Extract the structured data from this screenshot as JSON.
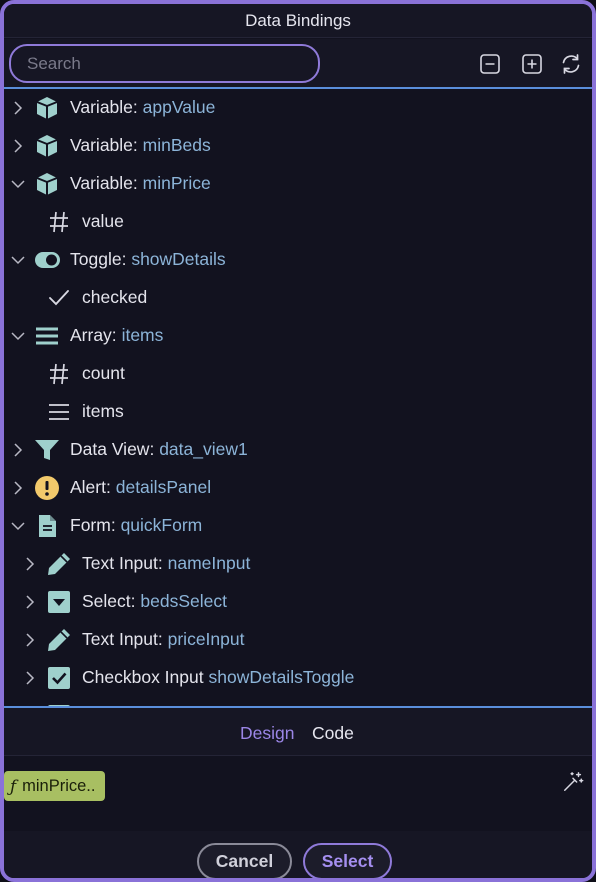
{
  "title": "Data Bindings",
  "search": {
    "placeholder": "Search",
    "value": ""
  },
  "toolbar": {
    "icons": [
      "collapse-all-icon",
      "expand-all-icon",
      "refresh-icon"
    ]
  },
  "tree": [
    {
      "type": "Variable:",
      "name": "appValue",
      "icon": "cube-icon",
      "depth": 0,
      "expanded": false
    },
    {
      "type": "Variable:",
      "name": "minBeds",
      "icon": "cube-icon",
      "depth": 0,
      "expanded": false
    },
    {
      "type": "Variable:",
      "name": "minPrice",
      "icon": "cube-icon",
      "depth": 0,
      "expanded": true
    },
    {
      "type": "value",
      "name": "",
      "icon": "hash-icon",
      "depth": 1,
      "leaf": true
    },
    {
      "type": "Toggle:",
      "name": "showDetails",
      "icon": "toggle-icon",
      "depth": 0,
      "expanded": true
    },
    {
      "type": "checked",
      "name": "",
      "icon": "check-icon",
      "depth": 1,
      "leaf": true
    },
    {
      "type": "Array:",
      "name": "items",
      "icon": "list-icon",
      "depth": 0,
      "expanded": true
    },
    {
      "type": "count",
      "name": "",
      "icon": "hash-icon",
      "depth": 1,
      "leaf": true
    },
    {
      "type": "items",
      "name": "",
      "icon": "list-thin-icon",
      "depth": 1,
      "leaf": true
    },
    {
      "type": "Data View:",
      "name": "data_view1",
      "icon": "filter-icon",
      "depth": 0,
      "expanded": false
    },
    {
      "type": "Alert:",
      "name": "detailsPanel",
      "icon": "alert-icon",
      "depth": 0,
      "expanded": false
    },
    {
      "type": "Form:",
      "name": "quickForm",
      "icon": "document-icon",
      "depth": 0,
      "expanded": true
    },
    {
      "type": "Text Input:",
      "name": "nameInput",
      "icon": "pencil-icon",
      "depth": 1,
      "expanded": false
    },
    {
      "type": "Select:",
      "name": "bedsSelect",
      "icon": "select-icon",
      "depth": 1,
      "expanded": false
    },
    {
      "type": "Text Input:",
      "name": "priceInput",
      "icon": "pencil-icon",
      "depth": 1,
      "expanded": false
    },
    {
      "type": "Checkbox Input",
      "name": "showDetailsToggle",
      "icon": "checkbox-icon",
      "depth": 1,
      "expanded": false
    }
  ],
  "tabs": {
    "design": "Design",
    "code": "Code",
    "active": "Design"
  },
  "expression": {
    "fn_symbol": "ƒ",
    "chip_label": "minPrice.."
  },
  "footer": {
    "cancel_label": "Cancel",
    "select_label": "Select"
  },
  "colors": {
    "accent": "#8f7ad9",
    "name_text": "#8cb4d8",
    "icon": "#9fd0cc",
    "chip": "#a8bf62",
    "divider": "#5a8edb"
  }
}
